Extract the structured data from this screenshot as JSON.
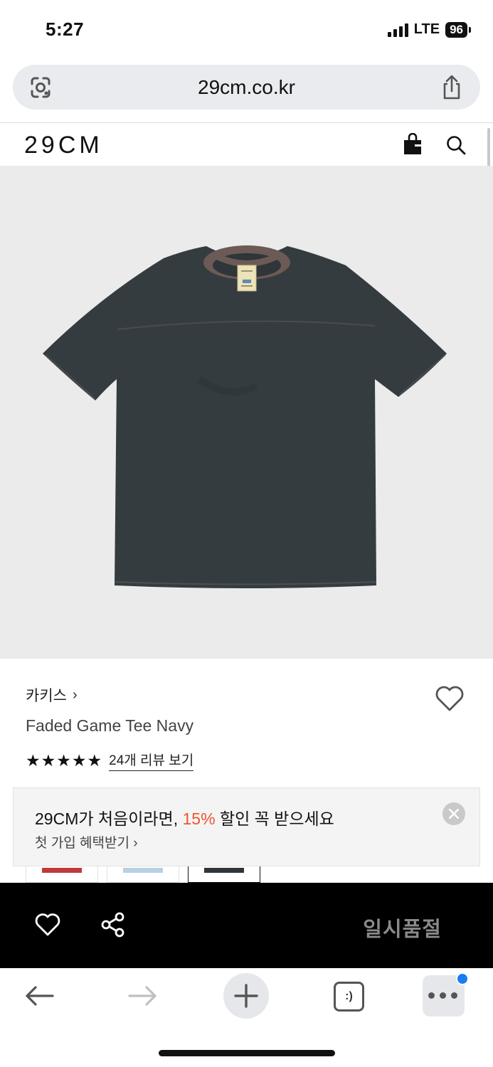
{
  "status_bar": {
    "time": "5:27",
    "network": "LTE",
    "battery": "96"
  },
  "browser": {
    "url": "29cm.co.kr",
    "lens_icon": "google-lens-icon",
    "share_icon": "share-icon"
  },
  "site_header": {
    "logo": "29CM",
    "bag_icon": "shopping-bag-icon",
    "search_icon": "search-icon"
  },
  "product": {
    "brand": "카키스",
    "brand_chevron": "›",
    "name": "Faded Game Tee Navy",
    "rating_stars": 5,
    "review_link": "24개 리뷰 보기",
    "image_colors": {
      "background": "#ebebeb",
      "shirt": "#343c40",
      "collar": "#6b5a55"
    }
  },
  "promo": {
    "title_prefix": "29CM가 처음이라면, ",
    "title_accent": "15%",
    "title_suffix": " 할인 꼭 받으세요",
    "subtitle": "첫 가입 혜택받기 ›",
    "accent_color": "#f0542e"
  },
  "swatches": [
    {
      "color": "#c0393b",
      "selected": false
    },
    {
      "color": "#b9cfe2",
      "selected": false
    },
    {
      "color": "#2f353a",
      "selected": true
    }
  ],
  "action_bar": {
    "soldout_label": "일시품절"
  },
  "browser_nav": {
    "tabs_label": ":)"
  }
}
